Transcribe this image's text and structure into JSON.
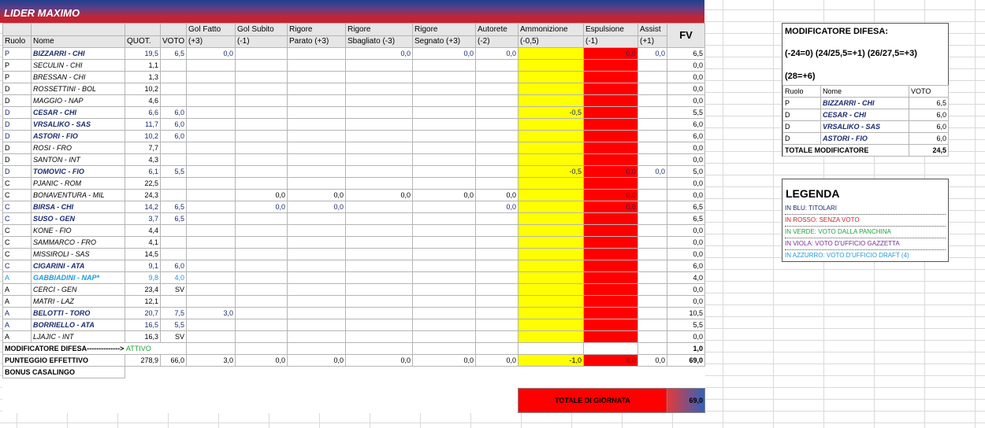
{
  "team_name": "LIDER MAXIMO",
  "headers": {
    "ruolo": "Ruolo",
    "nome": "Nome",
    "quot": "QUOT.",
    "voto": "VOTO",
    "gol_fatto": [
      "Gol Fatto",
      "(+3)"
    ],
    "gol_subito": [
      "Gol Subito",
      "(-1)"
    ],
    "rig_parato": [
      "Rigore",
      "Parato (+3)"
    ],
    "rig_sbagliato": [
      "Rigore",
      "Sbagliato (-3)"
    ],
    "rig_segnato": [
      "Rigore",
      "Segnato (+3)"
    ],
    "autorete": [
      "Autorete",
      "(-2)"
    ],
    "ammonizione": [
      "Ammonizione",
      "(-0,5)"
    ],
    "espulsione": [
      "Espulsione",
      "(-1)"
    ],
    "assist": [
      "Assist",
      "(+1)"
    ],
    "fv": "FV"
  },
  "players": [
    {
      "ruolo": "P",
      "nome": "BIZZARRI - CHI",
      "quot": "19,5",
      "voto": "6,5",
      "gf": "0,0",
      "gs": "",
      "rp": "",
      "rsb": "0,0",
      "rse": "0,0",
      "aut": "0,0",
      "amm": "",
      "esp": "0,0",
      "ass": "0,0",
      "fv": "6,5",
      "style": "blue"
    },
    {
      "ruolo": "P",
      "nome": "SECULIN - CHI",
      "quot": "1,1",
      "voto": "",
      "gf": "",
      "gs": "",
      "rp": "",
      "rsb": "",
      "rse": "",
      "aut": "",
      "amm": "",
      "esp": "",
      "ass": "",
      "fv": "0,0",
      "style": "plain"
    },
    {
      "ruolo": "P",
      "nome": "BRESSAN - CHI",
      "quot": "1,3",
      "voto": "",
      "gf": "",
      "gs": "",
      "rp": "",
      "rsb": "",
      "rse": "",
      "aut": "",
      "amm": "",
      "esp": "",
      "ass": "",
      "fv": "0,0",
      "style": "plain"
    },
    {
      "ruolo": "D",
      "nome": "ROSSETTINI - BOL",
      "quot": "10,2",
      "voto": "",
      "gf": "",
      "gs": "",
      "rp": "",
      "rsb": "",
      "rse": "",
      "aut": "",
      "amm": "",
      "esp": "",
      "ass": "",
      "fv": "0,0",
      "style": "plain"
    },
    {
      "ruolo": "D",
      "nome": "MAGGIO - NAP",
      "quot": "4,6",
      "voto": "",
      "gf": "",
      "gs": "",
      "rp": "",
      "rsb": "",
      "rse": "",
      "aut": "",
      "amm": "",
      "esp": "",
      "ass": "",
      "fv": "0,0",
      "style": "plain"
    },
    {
      "ruolo": "D",
      "nome": "CESAR - CHI",
      "quot": "6,6",
      "voto": "6,0",
      "gf": "",
      "gs": "",
      "rp": "",
      "rsb": "",
      "rse": "",
      "aut": "",
      "amm": "-0,5",
      "esp": "",
      "ass": "",
      "fv": "5,5",
      "style": "blue"
    },
    {
      "ruolo": "D",
      "nome": "VRSALIKO - SAS",
      "quot": "11,7",
      "voto": "6,0",
      "gf": "",
      "gs": "",
      "rp": "",
      "rsb": "",
      "rse": "",
      "aut": "",
      "amm": "",
      "esp": "",
      "ass": "",
      "fv": "6,0",
      "style": "blue"
    },
    {
      "ruolo": "D",
      "nome": "ASTORI - FIO",
      "quot": "10,2",
      "voto": "6,0",
      "gf": "",
      "gs": "",
      "rp": "",
      "rsb": "",
      "rse": "",
      "aut": "",
      "amm": "",
      "esp": "",
      "ass": "",
      "fv": "6,0",
      "style": "blue"
    },
    {
      "ruolo": "D",
      "nome": "ROSI - FRO",
      "quot": "7,7",
      "voto": "",
      "gf": "",
      "gs": "",
      "rp": "",
      "rsb": "",
      "rse": "",
      "aut": "",
      "amm": "",
      "esp": "",
      "ass": "",
      "fv": "0,0",
      "style": "plain"
    },
    {
      "ruolo": "D",
      "nome": "SANTON - INT",
      "quot": "4,3",
      "voto": "",
      "gf": "",
      "gs": "",
      "rp": "",
      "rsb": "",
      "rse": "",
      "aut": "",
      "amm": "",
      "esp": "",
      "ass": "",
      "fv": "0,0",
      "style": "plain"
    },
    {
      "ruolo": "D",
      "nome": "TOMOVIC - FIO",
      "quot": "6,1",
      "voto": "5,5",
      "gf": "",
      "gs": "",
      "rp": "",
      "rsb": "",
      "rse": "",
      "aut": "",
      "amm": "-0,5",
      "esp": "0,0",
      "ass": "0,0",
      "fv": "5,0",
      "style": "blue"
    },
    {
      "ruolo": "C",
      "nome": "PJANIC - ROM",
      "quot": "22,5",
      "voto": "",
      "gf": "",
      "gs": "",
      "rp": "",
      "rsb": "",
      "rse": "",
      "aut": "",
      "amm": "",
      "esp": "",
      "ass": "",
      "fv": "0,0",
      "style": "plain"
    },
    {
      "ruolo": "C",
      "nome": "BONAVENTURA - MIL",
      "quot": "24,3",
      "voto": "",
      "gf": "",
      "gs": "0,0",
      "rp": "0,0",
      "rsb": "0,0",
      "rse": "0,0",
      "aut": "0,0",
      "amm": "",
      "esp": "0,0",
      "ass": "",
      "fv": "0,0",
      "style": "plain"
    },
    {
      "ruolo": "C",
      "nome": "BIRSA - CHI",
      "quot": "14,2",
      "voto": "6,5",
      "gf": "",
      "gs": "0,0",
      "rp": "0,0",
      "rsb": "",
      "rse": "",
      "aut": "0,0",
      "amm": "",
      "esp": "0,0",
      "ass": "",
      "fv": "6,5",
      "style": "blue"
    },
    {
      "ruolo": "C",
      "nome": "SUSO - GEN",
      "quot": "3,7",
      "voto": "6,5",
      "gf": "",
      "gs": "",
      "rp": "",
      "rsb": "",
      "rse": "",
      "aut": "",
      "amm": "",
      "esp": "",
      "ass": "",
      "fv": "6,5",
      "style": "blue"
    },
    {
      "ruolo": "C",
      "nome": "KONE - FIO",
      "quot": "4,4",
      "voto": "",
      "gf": "",
      "gs": "",
      "rp": "",
      "rsb": "",
      "rse": "",
      "aut": "",
      "amm": "",
      "esp": "",
      "ass": "",
      "fv": "0,0",
      "style": "plain"
    },
    {
      "ruolo": "C",
      "nome": "SAMMARCO - FRO",
      "quot": "4,1",
      "voto": "",
      "gf": "",
      "gs": "",
      "rp": "",
      "rsb": "",
      "rse": "",
      "aut": "",
      "amm": "",
      "esp": "",
      "ass": "",
      "fv": "0,0",
      "style": "plain"
    },
    {
      "ruolo": "C",
      "nome": "MISSIROLI - SAS",
      "quot": "14,5",
      "voto": "",
      "gf": "",
      "gs": "",
      "rp": "",
      "rsb": "",
      "rse": "",
      "aut": "",
      "amm": "",
      "esp": "",
      "ass": "",
      "fv": "0,0",
      "style": "plain"
    },
    {
      "ruolo": "C",
      "nome": "CIGARINI - ATA",
      "quot": "9,1",
      "voto": "6,0",
      "gf": "",
      "gs": "",
      "rp": "",
      "rsb": "",
      "rse": "",
      "aut": "",
      "amm": "",
      "esp": "",
      "ass": "",
      "fv": "6,0",
      "style": "blue"
    },
    {
      "ruolo": "A",
      "nome": "GABBIADINI - NAP*",
      "quot": "9,8",
      "voto": "4,0",
      "gf": "",
      "gs": "",
      "rp": "",
      "rsb": "",
      "rse": "",
      "aut": "",
      "amm": "",
      "esp": "",
      "ass": "",
      "fv": "4,0",
      "style": "cyan"
    },
    {
      "ruolo": "A",
      "nome": "CERCI - GEN",
      "quot": "23,4",
      "voto": "SV",
      "gf": "",
      "gs": "",
      "rp": "",
      "rsb": "",
      "rse": "",
      "aut": "",
      "amm": "",
      "esp": "",
      "ass": "",
      "fv": "0,0",
      "style": "plain"
    },
    {
      "ruolo": "A",
      "nome": "MATRI - LAZ",
      "quot": "12,1",
      "voto": "",
      "gf": "",
      "gs": "",
      "rp": "",
      "rsb": "",
      "rse": "",
      "aut": "",
      "amm": "",
      "esp": "",
      "ass": "",
      "fv": "0,0",
      "style": "plain"
    },
    {
      "ruolo": "A",
      "nome": "BELOTTI - TORO",
      "quot": "20,7",
      "voto": "7,5",
      "gf": "3,0",
      "gs": "",
      "rp": "",
      "rsb": "",
      "rse": "",
      "aut": "",
      "amm": "",
      "esp": "",
      "ass": "",
      "fv": "10,5",
      "style": "blue"
    },
    {
      "ruolo": "A",
      "nome": "BORRIELLO - ATA",
      "quot": "16,5",
      "voto": "5,5",
      "gf": "",
      "gs": "",
      "rp": "",
      "rsb": "",
      "rse": "",
      "aut": "",
      "amm": "",
      "esp": "",
      "ass": "",
      "fv": "5,5",
      "style": "blue"
    },
    {
      "ruolo": "A",
      "nome": "LJAJIC - INT",
      "quot": "16,3",
      "voto": "SV",
      "gf": "",
      "gs": "",
      "rp": "",
      "rsb": "",
      "rse": "",
      "aut": "",
      "amm": "",
      "esp": "",
      "ass": "",
      "fv": "0,0",
      "style": "plain"
    }
  ],
  "modificatore_row": {
    "label": "MODIFICATORE DIFESA--------------> ",
    "status": "ATTIVO",
    "fv": "1,0"
  },
  "punteggio_row": {
    "label": "PUNTEGGIO EFFETTIVO",
    "quot": "278,9",
    "voto": "66,0",
    "gf": "3,0",
    "gs": "0,0",
    "rp": "0,0",
    "rsb": "0,0",
    "rse": "0,0",
    "aut": "0,0",
    "amm": "-1,0",
    "esp": "0,0",
    "ass": "0,0",
    "fv": "69,0"
  },
  "bonus_row": {
    "label": "BONUS CASALINGO"
  },
  "totale": {
    "label": "TOTALE DI GIORNATA",
    "value": "69,0"
  },
  "modificatore_box": {
    "title": "MODIFICATORE DIFESA:",
    "rule1": "(-24=0) (24/25,5=+1) (26/27,5=+3)",
    "rule2": "(28=+6)",
    "headers": {
      "ruolo": "Ruolo",
      "nome": "Nome",
      "voto": "VOTO"
    },
    "rows": [
      {
        "ruolo": "P",
        "nome": "BIZZARRI - CHI",
        "voto": "6,5"
      },
      {
        "ruolo": "D",
        "nome": "CESAR - CHI",
        "voto": "6,0"
      },
      {
        "ruolo": "D",
        "nome": "VRSALIKO - SAS",
        "voto": "6,0"
      },
      {
        "ruolo": "D",
        "nome": "ASTORI - FIO",
        "voto": "6,0"
      }
    ],
    "total_label": "TOTALE MODIFICATORE",
    "total_value": "24,5"
  },
  "legenda": {
    "title": "LEGENDA",
    "items": [
      {
        "text": "IN BLU: TITOLARI",
        "color": "#1a2a6c"
      },
      {
        "text": "IN ROSSO: SENZA VOTO",
        "color": "#d01e2a"
      },
      {
        "text": "IN VERDE: VOTO DALLA PANCHINA",
        "color": "#1ea43a"
      },
      {
        "text": "IN VIOLA: VOTO D'UFFICIO GAZZETTA",
        "color": "#7a2a9a"
      },
      {
        "text": "IN AZZURRO: VOTO D'UFFICIO DRAFT (4)",
        "color": "#1e9bd8"
      }
    ]
  },
  "colors": {
    "ammonizione": "#ffff00",
    "espulsione": "#ff0000",
    "titolari": "#1a2a6c",
    "draft": "#1e9bd8",
    "attivo": "#1ea43a"
  }
}
